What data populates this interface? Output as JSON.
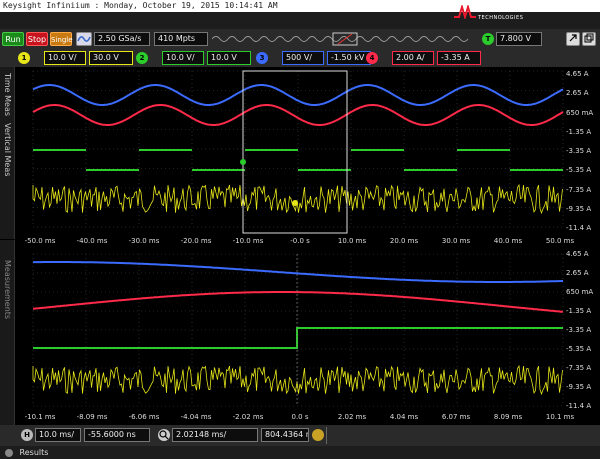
{
  "titlebar": {
    "text": "Keysight Infiniium : Monday, October 19, 2015 10:14:41 AM"
  },
  "brand": {
    "name": "KEYSIGHT",
    "sub": "TECHNOLOGIES"
  },
  "controls": {
    "run": "Run",
    "stop": "Stop",
    "single": "Single",
    "sample_rate": "2.50 GSa/s",
    "memory_depth": "410 Mpts",
    "trigger_badge": "T",
    "trigger_level": "7.800 V"
  },
  "channels": [
    {
      "num": "1",
      "scale": "10.0 V/",
      "offset": "30.0 V",
      "color": "#e6e619"
    },
    {
      "num": "2",
      "scale": "10.0 V/",
      "offset": "10.0 V",
      "color": "#2bcc2b"
    },
    {
      "num": "3",
      "scale": "500 V/",
      "offset": "-1.50 kV",
      "color": "#3b6bff"
    },
    {
      "num": "4",
      "scale": "2.00 A/",
      "offset": "-3.35 A",
      "color": "#ff2a4a"
    }
  ],
  "side_tabs": {
    "time_meas": "Time Meas",
    "vertical_meas": "Vertical Meas",
    "measurements": "Measurements"
  },
  "top_grid": {
    "right_labels": [
      "4.65 A",
      "2.65 A",
      "650 mA",
      "-1.35 A",
      "-3.35 A",
      "-5.35 A",
      "-7.35 A",
      "-9.35 A",
      "-11.4 A"
    ],
    "x_labels": [
      "-50.0 ms",
      "-40.0 ms",
      "-30.0 ms",
      "-20.0 ms",
      "-10.0 ms",
      "-0.0 s",
      "10.0 ms",
      "20.0 ms",
      "30.0 ms",
      "40.0 ms",
      "50.0 ms"
    ]
  },
  "bottom_grid": {
    "right_labels": [
      "4.65 A",
      "2.65 A",
      "650 mA",
      "-1.35 A",
      "-3.35 A",
      "-5.35 A",
      "-7.35 A",
      "-9.35 A",
      "-11.4 A"
    ],
    "x_labels": [
      "-10.1 ms",
      "-8.09 ms",
      "-6.06 ms",
      "-4.04 ms",
      "-2.02 ms",
      "0.0 s",
      "2.02 ms",
      "4.04 ms",
      "6.07 ms",
      "8.09 ms",
      "10.1 ms"
    ]
  },
  "timebase": {
    "badge": "H",
    "scale": "10.0 ms/",
    "position": "-55.6000 ns",
    "zoom_scale": "2.02148 ms/",
    "zoom_position": "804.4364 ns"
  },
  "results": {
    "label": "Results"
  },
  "colors": {
    "ch1": "#e6e619",
    "ch2": "#2bcc2b",
    "ch3": "#3b6bff",
    "ch4": "#ff2a4a",
    "grid": "#444444"
  }
}
